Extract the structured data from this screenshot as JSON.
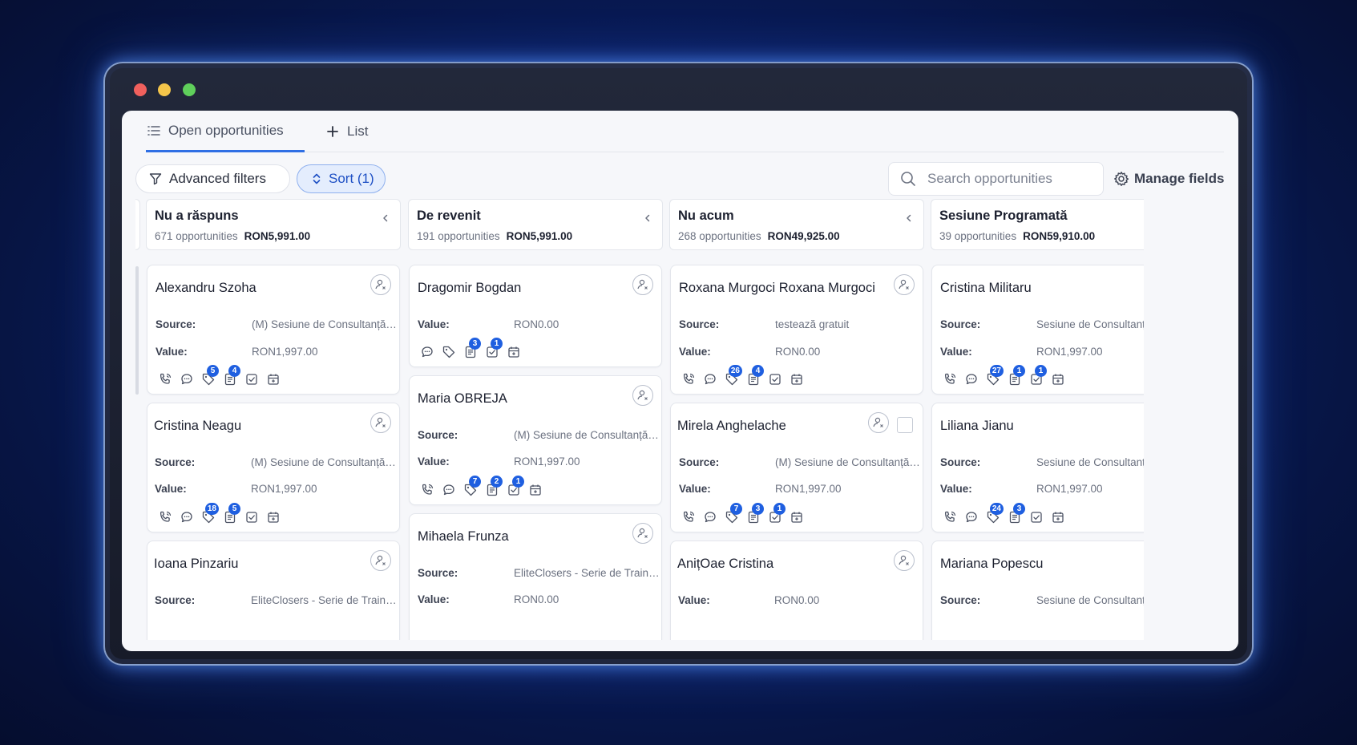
{
  "tabs": {
    "active": "Open opportunities",
    "add": "List"
  },
  "toolbar": {
    "filters_label": "Advanced filters",
    "sort_label": "Sort (1)",
    "search_placeholder": "Search opportunities",
    "manage_label": "Manage fields"
  },
  "labels": {
    "source": "Source:",
    "value": "Value:"
  },
  "columns": [
    {
      "title": "Nu a răspuns",
      "count": "671 opportunities",
      "amount": "RON5,991.00",
      "cards": [
        {
          "name": "Alexandru Szoha",
          "source": "(M) Sesiune de Consultanță …",
          "value": "RON1,997.00",
          "badges": {
            "call": "",
            "chat": "",
            "tag": "5",
            "note": "4",
            "task": "",
            "cal": ""
          }
        },
        {
          "name": "Cristina Neagu",
          "source": "(M) Sesiune de Consultanță …",
          "value": "RON1,997.00",
          "badges": {
            "call": "",
            "chat": "",
            "tag": "18",
            "note": "5",
            "task": "",
            "cal": ""
          }
        },
        {
          "name": "Ioana Pinzariu",
          "source": "EliteClosers - Serie de Traini…",
          "value": ""
        }
      ]
    },
    {
      "title": "De revenit",
      "count": "191 opportunities",
      "amount": "RON5,991.00",
      "cards": [
        {
          "name": "Dragomir Bogdan",
          "value": "RON0.00",
          "badges": {
            "chat": "",
            "tag": "",
            "note": "3",
            "task": "1",
            "cal": ""
          }
        },
        {
          "name": "Maria OBREJA",
          "source": "(M) Sesiune de Consultanță …",
          "value": "RON1,997.00",
          "badges": {
            "call": "",
            "chat": "",
            "tag": "7",
            "note": "2",
            "task": "1",
            "cal": ""
          }
        },
        {
          "name": "Mihaela Frunza",
          "source": "EliteClosers - Serie de Traini…",
          "value": "RON0.00"
        }
      ]
    },
    {
      "title": "Nu acum",
      "count": "268 opportunities",
      "amount": "RON49,925.00",
      "cards": [
        {
          "name": "Roxana Murgoci Roxana Murgoci",
          "source": "testează gratuit",
          "value": "RON0.00",
          "badges": {
            "call": "",
            "chat": "",
            "tag": "26",
            "note": "4",
            "task": "",
            "cal": ""
          }
        },
        {
          "name": "Mirela Anghelache",
          "source": "(M) Sesiune de Consultanță …",
          "value": "RON1,997.00",
          "badges": {
            "call": "",
            "chat": "",
            "tag": "7",
            "note": "3",
            "task": "1",
            "cal": ""
          }
        },
        {
          "name": "AnițOae Cristina",
          "value": "RON0.00"
        }
      ]
    },
    {
      "title": "Sesiune Programată",
      "count": "39 opportunities",
      "amount": "RON59,910.00",
      "cards": [
        {
          "name": "Cristina Militaru",
          "source": "Sesiune de Consultanță c",
          "value": "RON1,997.00",
          "badges": {
            "call": "",
            "chat": "",
            "tag": "27",
            "note": "1",
            "task": "1",
            "cal": ""
          }
        },
        {
          "name": "Liliana Jianu",
          "source": "Sesiune de Consultanță c",
          "value": "RON1,997.00",
          "badges": {
            "call": "",
            "chat": "",
            "tag": "24",
            "note": "3",
            "task": "",
            "cal": ""
          }
        },
        {
          "name": "Mariana Popescu",
          "source": "Sesiune de Consultanță c",
          "value": ""
        }
      ]
    }
  ]
}
